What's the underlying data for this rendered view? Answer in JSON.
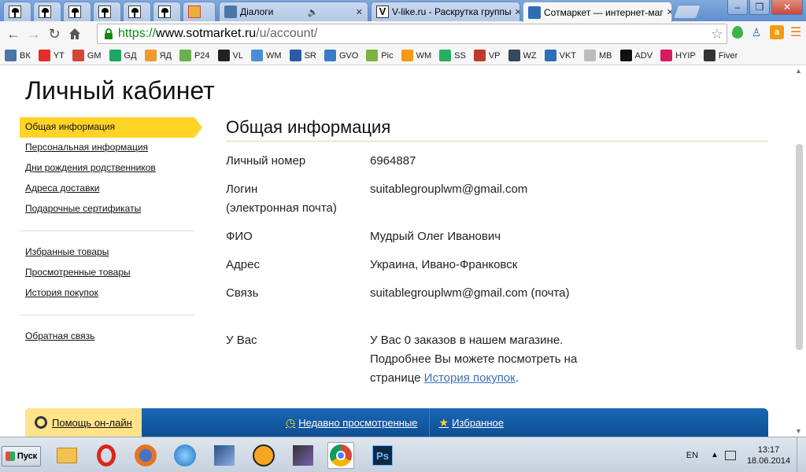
{
  "browser": {
    "tabs": [
      {
        "title": "",
        "type": "pinned"
      },
      {
        "title": "",
        "type": "pinned"
      },
      {
        "title": "",
        "type": "pinned"
      },
      {
        "title": "",
        "type": "pinned"
      },
      {
        "title": "",
        "type": "pinned"
      },
      {
        "title": "",
        "type": "pinned"
      },
      {
        "title": "",
        "type": "pinned"
      },
      {
        "title": "Діалоги"
      },
      {
        "title": "V-like.ru - Раскрутка группы"
      },
      {
        "title": "Сотмаркет — интернет-маг"
      }
    ],
    "address": {
      "scheme": "https://",
      "host": "www.sotmarket.ru",
      "path": "/u/account/"
    },
    "bookmarks": [
      {
        "label": "ВК",
        "color": "#4a76a8"
      },
      {
        "label": "YT",
        "color": "#e52d27"
      },
      {
        "label": "GM",
        "color": "#d44638"
      },
      {
        "label": "GД",
        "color": "#1fa463"
      },
      {
        "label": "ЯД",
        "color": "#f2992e"
      },
      {
        "label": "P24",
        "color": "#6ab04c"
      },
      {
        "label": "VL",
        "color": "#222222"
      },
      {
        "label": "WM",
        "color": "#4a8fd6"
      },
      {
        "label": "SR",
        "color": "#2d5aa6"
      },
      {
        "label": "GVO",
        "color": "#3a7bc8"
      },
      {
        "label": "Pic",
        "color": "#7cb342"
      },
      {
        "label": "WM",
        "color": "#f39c12"
      },
      {
        "label": "SS",
        "color": "#27ae60"
      },
      {
        "label": "VP",
        "color": "#c0392b"
      },
      {
        "label": "WZ",
        "color": "#34495e"
      },
      {
        "label": "VKT",
        "color": "#2c6fb7"
      },
      {
        "label": "MB",
        "color": "#bbbbbb"
      },
      {
        "label": "ADV",
        "color": "#111111"
      },
      {
        "label": "HYIP",
        "color": "#d81b60"
      },
      {
        "label": "Fiver",
        "color": "#333333"
      }
    ]
  },
  "page": {
    "title": "Личный кабинет",
    "sidebar": {
      "group1": [
        {
          "label": "Общая информация",
          "active": true
        },
        {
          "label": "Персональная информация"
        },
        {
          "label": "Дни рождения родственников"
        },
        {
          "label": "Адреса доставки"
        },
        {
          "label": "Подарочные сертификаты"
        }
      ],
      "group2": [
        {
          "label": "Избранные товары"
        },
        {
          "label": "Просмотренные товары"
        },
        {
          "label": "История покупок"
        }
      ],
      "group3": [
        {
          "label": "Обратная связь"
        }
      ]
    },
    "section_title": "Общая информация",
    "rows": [
      {
        "label": "Личный номер",
        "value": "6964887"
      },
      {
        "label": "Логин",
        "label2": "(электронная почта)",
        "value": "suitablegrouplwm@gmail.com"
      },
      {
        "label": "ФИО",
        "value": "Мудрый Олег Иванович"
      },
      {
        "label": "Адрес",
        "value": "Украина, Ивано-Франковск"
      },
      {
        "label": "Связь",
        "value": "suitablegrouplwm@gmail.com (почта)"
      }
    ],
    "orders": {
      "label": "У Вас",
      "line1": "У Вас 0 заказов в нашем магазине.",
      "line2": "Подробнее Вы можете посмотреть на",
      "line3_prefix": "странице ",
      "link": "История покупок",
      "line3_suffix": "."
    },
    "bottombar": {
      "help": "Помощь он-лайн",
      "recent": "Недавно просмотренные",
      "favorites": "Избранное"
    }
  },
  "taskbar": {
    "start": "Пуск",
    "lang": "EN",
    "time": "13:17",
    "date": "18.06.2014"
  }
}
